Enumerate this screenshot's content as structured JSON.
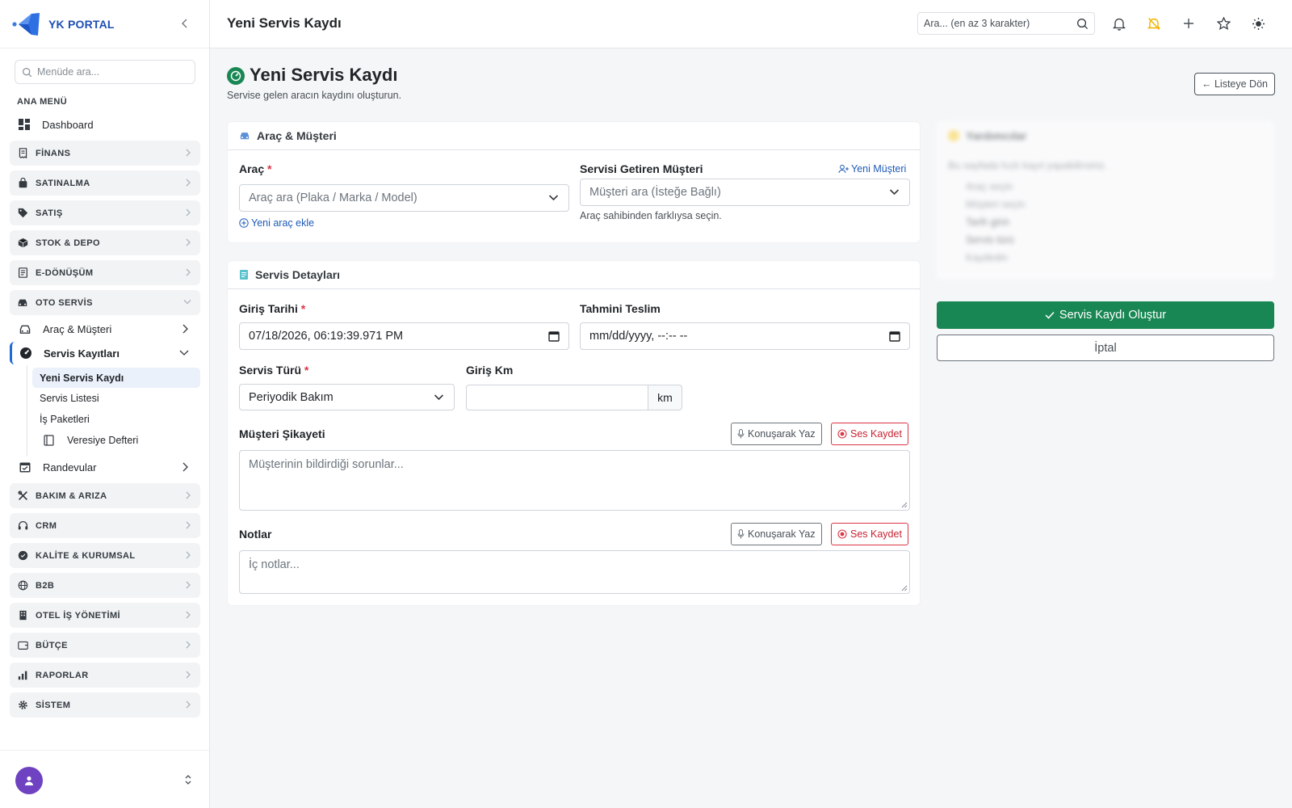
{
  "brand": {
    "name": "YK PORTAL"
  },
  "sidebar": {
    "search_placeholder": "Menüde ara...",
    "section_title": "ANA MENÜ",
    "dashboard": "Dashboard",
    "groups": [
      {
        "label": "FİNANS",
        "icon": "receipt-icon"
      },
      {
        "label": "SATINALMA",
        "icon": "bag-icon"
      },
      {
        "label": "SATIŞ",
        "icon": "tag-icon"
      },
      {
        "label": "STOK & DEPO",
        "icon": "box-icon"
      },
      {
        "label": "E-DÖNÜŞÜM",
        "icon": "document-icon"
      },
      {
        "label": "OTO SERVİS",
        "icon": "car-icon"
      },
      {
        "label": "BAKIM & ARIZA",
        "icon": "tools-icon"
      },
      {
        "label": "CRM",
        "icon": "headset-icon"
      },
      {
        "label": "KALİTE & KURUMSAL",
        "icon": "badge-check-icon"
      },
      {
        "label": "B2B",
        "icon": "globe-icon"
      },
      {
        "label": "OTEL İŞ YÖNETİMİ",
        "icon": "building-icon"
      },
      {
        "label": "BÜTÇE",
        "icon": "wallet-icon"
      },
      {
        "label": "RAPORLAR",
        "icon": "bar-chart-icon"
      },
      {
        "label": "SİSTEM",
        "icon": "gear-icon"
      }
    ],
    "oto_servis_items": [
      {
        "label": "Araç & Müşteri"
      },
      {
        "label": "Servis Kayıtları"
      }
    ],
    "servis_kayitlari_children": [
      {
        "label": "Yeni Servis Kaydı"
      },
      {
        "label": "Servis Listesi"
      },
      {
        "label": "İş Paketleri"
      },
      {
        "label": "Veresiye Defteri"
      }
    ],
    "randevular": "Randevular"
  },
  "topbar": {
    "title": "Yeni Servis Kaydı",
    "search_placeholder": "Ara... (en az 3 karakter)"
  },
  "page": {
    "title": "Yeni Servis Kaydı",
    "subtitle": "Servise gelen aracın kaydını oluşturun.",
    "back_button": "← Listeye Dön"
  },
  "vehicle_card": {
    "title": "Araç & Müşteri",
    "arac_label": "Araç",
    "arac_placeholder": "Araç ara (Plaka / Marka / Model)",
    "new_vehicle_link": "Yeni araç ekle",
    "customer_label": "Servisi Getiren Müşteri",
    "new_customer_link": "Yeni Müşteri",
    "customer_placeholder": "Müşteri ara (İsteğe Bağlı)",
    "customer_hint": "Araç sahibinden farklıysa seçin."
  },
  "details_card": {
    "title": "Servis Detayları",
    "entry_date_label": "Giriş Tarihi",
    "entry_date_value": "07/18/2026, 06:19:39.971 PM",
    "delivery_label": "Tahmini Teslim",
    "delivery_value": "mm/dd/yyyy, --:-- --",
    "service_type_label": "Servis Türü",
    "service_type_value": "Periyodik Bakım",
    "km_label": "Giriş Km",
    "km_value": "",
    "km_unit": "km",
    "complaint_label": "Müşteri Şikayeti",
    "complaint_placeholder": "Müşterinin bildirdiği sorunlar...",
    "notes_label": "Notlar",
    "notes_placeholder": "İç notlar...",
    "speak_button": "Konuşarak Yaz",
    "record_button": "Ses Kaydet"
  },
  "help_panel": {
    "title": "Yardımcılar",
    "intro": "Bu sayfada hızlı kayıt yapabilirsiniz.",
    "items": [
      "Araç seçin",
      "Müşteri seçin",
      "Tarih girin",
      "Servis türü",
      "Kaydedin"
    ]
  },
  "actions": {
    "submit": "Servis Kaydı Oluştur",
    "cancel": "İptal"
  },
  "colors": {
    "primary_green": "#198754",
    "link_blue": "#1e5ab7",
    "danger_red": "#dc3545",
    "brand_blue": "#1e4fb4"
  }
}
